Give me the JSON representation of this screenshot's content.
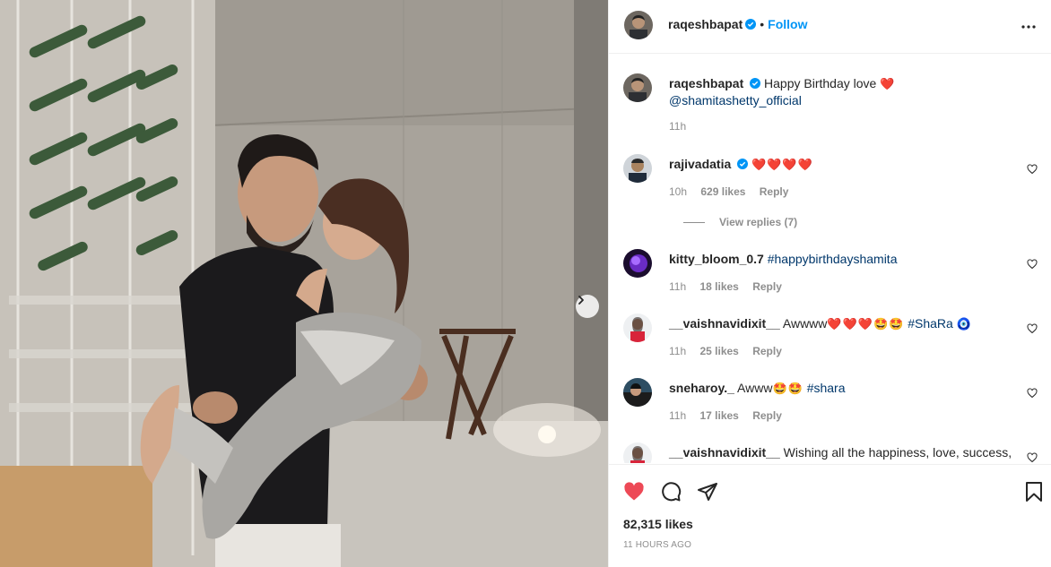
{
  "post": {
    "author": "raqeshbapat",
    "follow_label": "Follow",
    "dot": "•",
    "verified_color": "#0095f6",
    "accent_color": "#0095f6",
    "like_color": "#ed4956"
  },
  "caption": {
    "author": "raqeshbapat",
    "text": "Happy Birthday love",
    "emoji": "❤️",
    "mention": "@shamitashetty_official",
    "time": "11h"
  },
  "comments": [
    {
      "author": "rajivadatia",
      "verified": true,
      "text": "",
      "emoji": "❤️❤️❤️❤️",
      "hashtag": "",
      "time": "10h",
      "likes": "629 likes",
      "reply": "Reply",
      "view_replies": "View replies (7)"
    },
    {
      "author": "kitty_bloom_0.7",
      "verified": false,
      "text": "",
      "emoji": "",
      "hashtag": "#happybirthdayshamita",
      "time": "11h",
      "likes": "18 likes",
      "reply": "Reply"
    },
    {
      "author": "__vaishnavidixit__",
      "verified": false,
      "text": "Awwww",
      "emoji": "❤️❤️❤️🤩🤩",
      "hashtag": "#ShaRa",
      "extra_emoji": "🧿",
      "time": "11h",
      "likes": "25 likes",
      "reply": "Reply"
    },
    {
      "author": "sneharoy._",
      "verified": false,
      "text": "Awww",
      "emoji": "🤩🤩",
      "hashtag": "#shara",
      "time": "11h",
      "likes": "17 likes",
      "reply": "Reply"
    },
    {
      "author": "__vaishnavidixit__",
      "verified": false,
      "text": "Wishing all the happiness, love, success,",
      "emoji": "",
      "hashtag": ""
    }
  ],
  "footer": {
    "likes": "82,315 likes",
    "time_ago": "11 HOURS AGO"
  },
  "icons": {
    "more": "more-horizontal-icon",
    "like": "heart-filled-icon",
    "comment": "comment-bubble-icon",
    "share": "paper-plane-icon",
    "save": "bookmark-icon",
    "next": "chevron-right-icon"
  }
}
